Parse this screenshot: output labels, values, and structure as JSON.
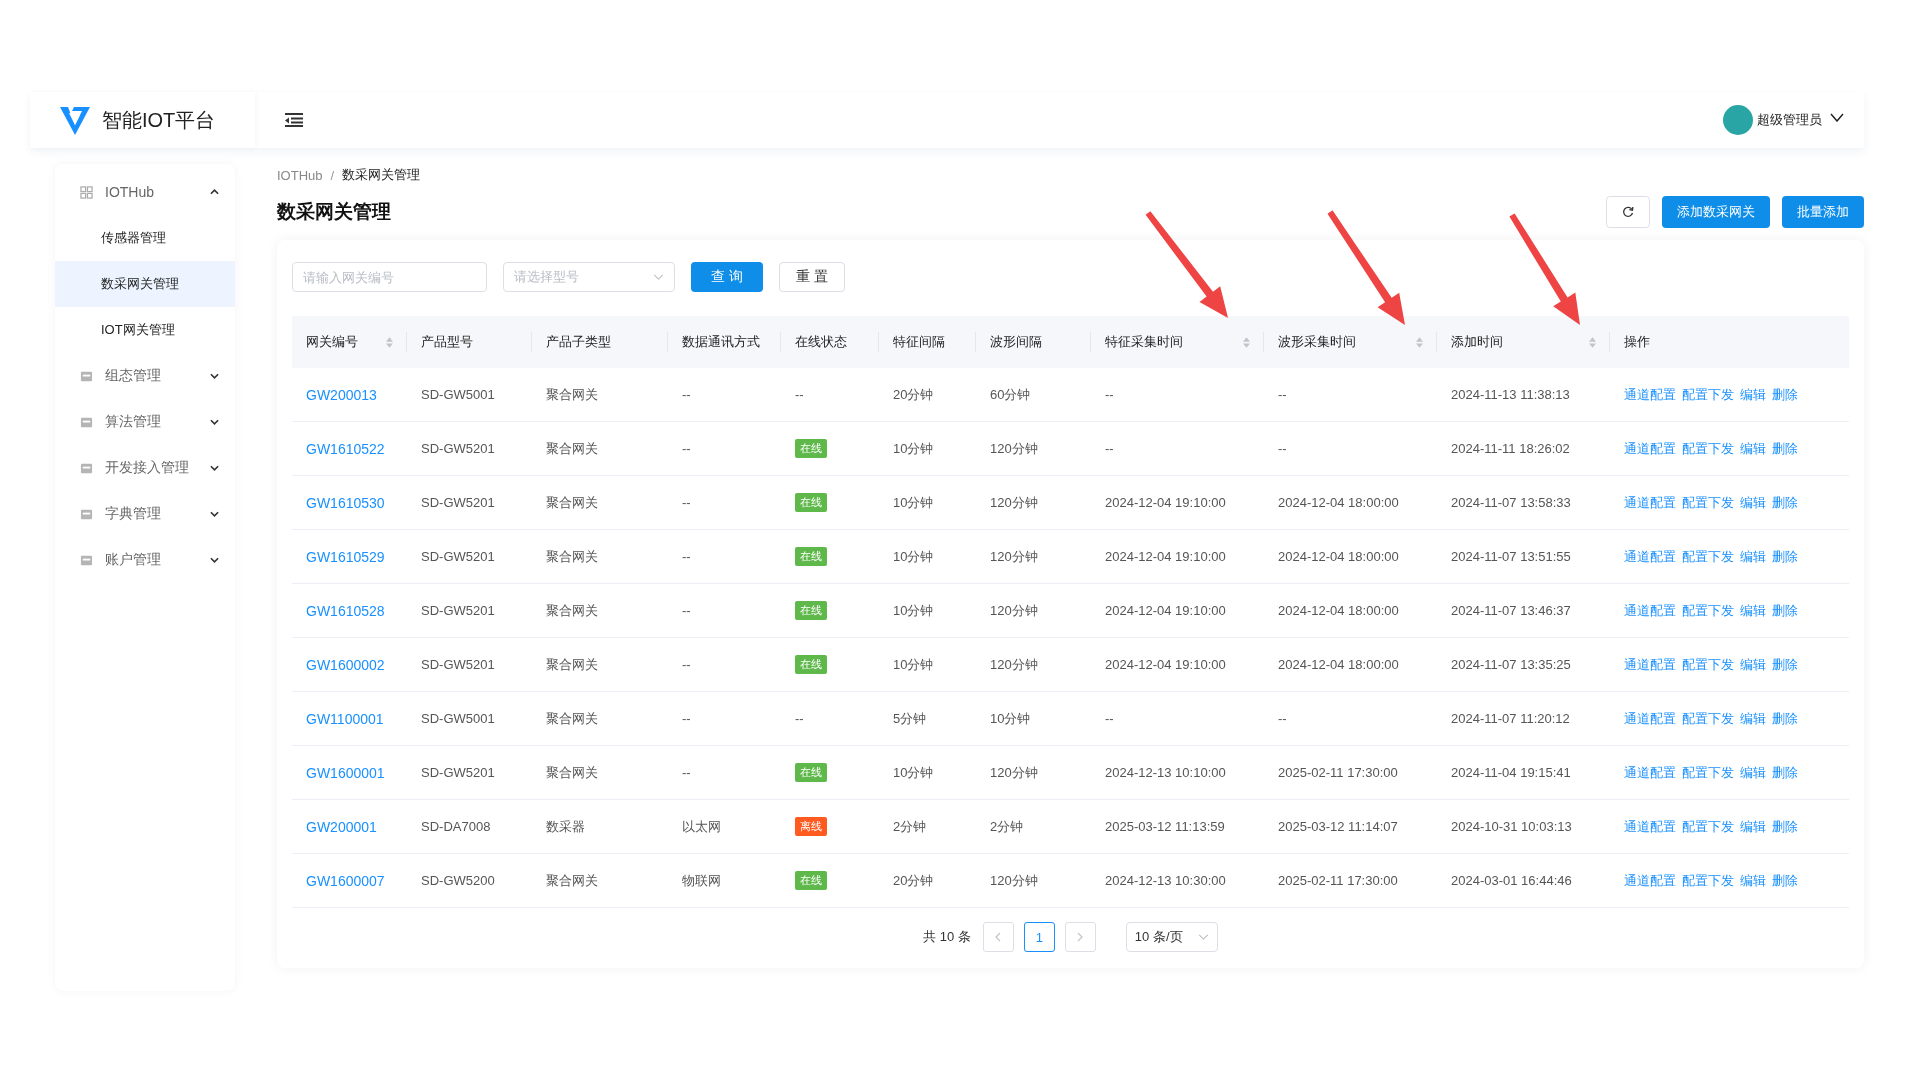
{
  "brand": {
    "name": "智能IOT平台"
  },
  "user": {
    "name": "超级管理员"
  },
  "sidebar": {
    "items": [
      {
        "label": "IOTHub",
        "expanded": true,
        "children": [
          {
            "label": "传感器管理",
            "selected": false
          },
          {
            "label": "数采网关管理",
            "selected": true
          },
          {
            "label": "IOT网关管理",
            "selected": false
          }
        ]
      },
      {
        "label": "组态管理",
        "expanded": false
      },
      {
        "label": "算法管理",
        "expanded": false
      },
      {
        "label": "开发接入管理",
        "expanded": false
      },
      {
        "label": "字典管理",
        "expanded": false
      },
      {
        "label": "账户管理",
        "expanded": false
      }
    ]
  },
  "breadcrumb": [
    "IOTHub",
    "数采网关管理"
  ],
  "breadcrumb_separator": "/",
  "page_title": "数采网关管理",
  "buttons": [
    "添加数采网关",
    "批量添加"
  ],
  "filters": {
    "gateway_placeholder": "请输入网关编号",
    "model_placeholder": "请选择型号",
    "query_button": "查 询",
    "reset_button": "重 置"
  },
  "table": {
    "columns": [
      {
        "label": "网关编号",
        "sortable": true
      },
      {
        "label": "产品型号",
        "sortable": false
      },
      {
        "label": "产品子类型",
        "sortable": false
      },
      {
        "label": "数据通讯方式",
        "sortable": false
      },
      {
        "label": "在线状态",
        "sortable": false
      },
      {
        "label": "特征间隔",
        "sortable": false
      },
      {
        "label": "波形间隔",
        "sortable": false
      },
      {
        "label": "特征采集时间",
        "sortable": true
      },
      {
        "label": "波形采集时间",
        "sortable": true
      },
      {
        "label": "添加时间",
        "sortable": true
      },
      {
        "label": "操作",
        "sortable": false
      }
    ],
    "rows": [
      {
        "id": "GW200013",
        "model": "SD-GW5001",
        "subtype": "聚合网关",
        "comm": "--",
        "status": {
          "kind": "none",
          "label": "--"
        },
        "feature_interval": "20分钟",
        "wave_interval": "60分钟",
        "feature_time": "--",
        "wave_time": "--",
        "added": "2024-11-13 11:38:13",
        "actions": [
          "通道配置",
          "配置下发",
          "编辑",
          "删除"
        ]
      },
      {
        "id": "GW1610522",
        "model": "SD-GW5201",
        "subtype": "聚合网关",
        "comm": "--",
        "status": {
          "kind": "online",
          "label": "在线"
        },
        "feature_interval": "10分钟",
        "wave_interval": "120分钟",
        "feature_time": "--",
        "wave_time": "--",
        "added": "2024-11-11 18:26:02",
        "actions": [
          "通道配置",
          "配置下发",
          "编辑",
          "删除"
        ]
      },
      {
        "id": "GW1610530",
        "model": "SD-GW5201",
        "subtype": "聚合网关",
        "comm": "--",
        "status": {
          "kind": "online",
          "label": "在线"
        },
        "feature_interval": "10分钟",
        "wave_interval": "120分钟",
        "feature_time": "2024-12-04 19:10:00",
        "wave_time": "2024-12-04 18:00:00",
        "added": "2024-11-07 13:58:33",
        "actions": [
          "通道配置",
          "配置下发",
          "编辑",
          "删除"
        ]
      },
      {
        "id": "GW1610529",
        "model": "SD-GW5201",
        "subtype": "聚合网关",
        "comm": "--",
        "status": {
          "kind": "online",
          "label": "在线"
        },
        "feature_interval": "10分钟",
        "wave_interval": "120分钟",
        "feature_time": "2024-12-04 19:10:00",
        "wave_time": "2024-12-04 18:00:00",
        "added": "2024-11-07 13:51:55",
        "actions": [
          "通道配置",
          "配置下发",
          "编辑",
          "删除"
        ]
      },
      {
        "id": "GW1610528",
        "model": "SD-GW5201",
        "subtype": "聚合网关",
        "comm": "--",
        "status": {
          "kind": "online",
          "label": "在线"
        },
        "feature_interval": "10分钟",
        "wave_interval": "120分钟",
        "feature_time": "2024-12-04 19:10:00",
        "wave_time": "2024-12-04 18:00:00",
        "added": "2024-11-07 13:46:37",
        "actions": [
          "通道配置",
          "配置下发",
          "编辑",
          "删除"
        ]
      },
      {
        "id": "GW1600002",
        "model": "SD-GW5201",
        "subtype": "聚合网关",
        "comm": "--",
        "status": {
          "kind": "online",
          "label": "在线"
        },
        "feature_interval": "10分钟",
        "wave_interval": "120分钟",
        "feature_time": "2024-12-04 19:10:00",
        "wave_time": "2024-12-04 18:00:00",
        "added": "2024-11-07 13:35:25",
        "actions": [
          "通道配置",
          "配置下发",
          "编辑",
          "删除"
        ]
      },
      {
        "id": "GW1100001",
        "model": "SD-GW5001",
        "subtype": "聚合网关",
        "comm": "--",
        "status": {
          "kind": "none",
          "label": "--"
        },
        "feature_interval": "5分钟",
        "wave_interval": "10分钟",
        "feature_time": "--",
        "wave_time": "--",
        "added": "2024-11-07 11:20:12",
        "actions": [
          "通道配置",
          "配置下发",
          "编辑",
          "删除"
        ]
      },
      {
        "id": "GW1600001",
        "model": "SD-GW5201",
        "subtype": "聚合网关",
        "comm": "--",
        "status": {
          "kind": "online",
          "label": "在线"
        },
        "feature_interval": "10分钟",
        "wave_interval": "120分钟",
        "feature_time": "2024-12-13 10:10:00",
        "wave_time": "2025-02-11 17:30:00",
        "added": "2024-11-04 19:15:41",
        "actions": [
          "通道配置",
          "配置下发",
          "编辑",
          "删除"
        ]
      },
      {
        "id": "GW200001",
        "model": "SD-DA7008",
        "subtype": "数采器",
        "comm": "以太网",
        "status": {
          "kind": "offline",
          "label": "离线"
        },
        "feature_interval": "2分钟",
        "wave_interval": "2分钟",
        "feature_time": "2025-03-12 11:13:59",
        "wave_time": "2025-03-12 11:14:07",
        "added": "2024-10-31 10:03:13",
        "actions": [
          "通道配置",
          "配置下发",
          "编辑",
          "删除"
        ]
      },
      {
        "id": "GW1600007",
        "model": "SD-GW5200",
        "subtype": "聚合网关",
        "comm": "物联网",
        "status": {
          "kind": "online",
          "label": "在线"
        },
        "feature_interval": "20分钟",
        "wave_interval": "120分钟",
        "feature_time": "2024-12-13 10:30:00",
        "wave_time": "2025-02-11 17:30:00",
        "added": "2024-03-01 16:44:46",
        "actions": [
          "通道配置",
          "配置下发",
          "编辑",
          "删除"
        ]
      }
    ]
  },
  "pagination": {
    "total": "共 10 条",
    "pages": [
      {
        "label": "1",
        "selected": true
      }
    ],
    "page_size": "10 条/页"
  }
}
